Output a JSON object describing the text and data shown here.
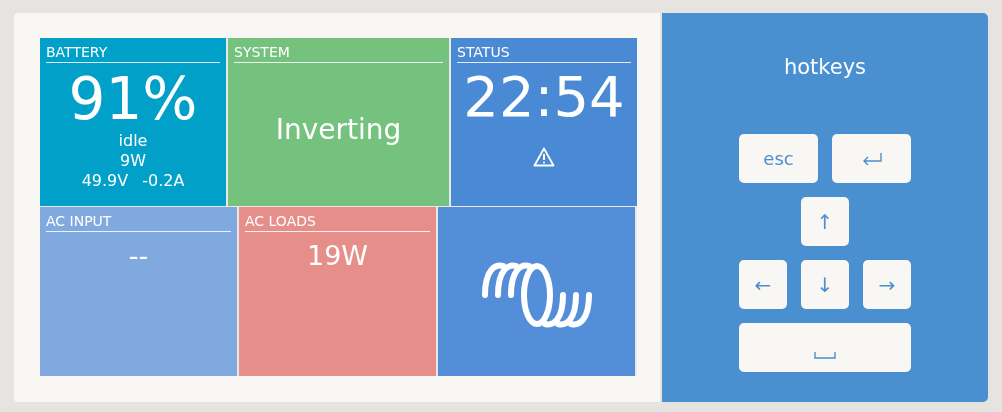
{
  "tiles_top": [
    {
      "kind": "battery",
      "title": "BATTERY",
      "color": "#00a0c8",
      "value": "91%",
      "lines": [
        "idle",
        "9W"
      ],
      "voltage": "49.9V",
      "current": "-0.2A"
    },
    {
      "kind": "system",
      "title": "SYSTEM",
      "color": "#75c27f",
      "value": "Inverting"
    },
    {
      "kind": "status",
      "title": "STATUS",
      "color": "#4a89d3",
      "value": "22:54",
      "warning": true
    }
  ],
  "tiles_bottom": [
    {
      "kind": "value",
      "title": "AC INPUT",
      "color": "#80aadf",
      "value": "--"
    },
    {
      "kind": "value",
      "title": "AC LOADS",
      "color": "#e68e8a",
      "value": "19W"
    },
    {
      "kind": "logo",
      "color": "#548ed8"
    }
  ],
  "hotkeys": {
    "title": "hotkeys",
    "keys": [
      {
        "kind": "text",
        "label": "esc"
      },
      {
        "kind": "enter"
      },
      {
        "kind": "arrow",
        "label": "↑"
      },
      {
        "kind": "arrow",
        "label": "←"
      },
      {
        "kind": "arrow",
        "label": "↓"
      },
      {
        "kind": "arrow",
        "label": "→"
      },
      {
        "kind": "space"
      }
    ]
  }
}
